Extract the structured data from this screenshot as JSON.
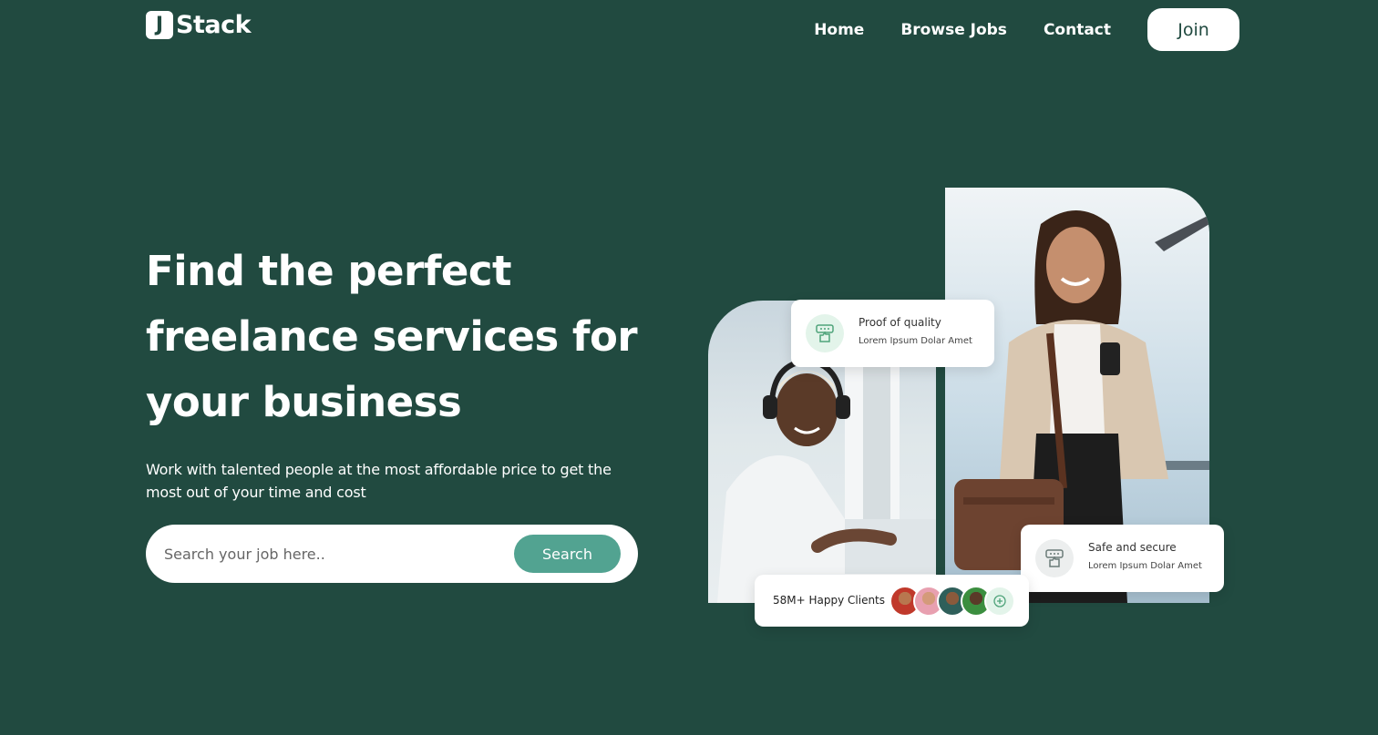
{
  "brand": {
    "mark": "J",
    "name": "Stack"
  },
  "nav": {
    "items": [
      "Home",
      "Browse Jobs",
      "Contact"
    ],
    "join_label": "Join"
  },
  "hero": {
    "title_lines": [
      "Find the perfect",
      "freelance services for",
      "your business"
    ],
    "subtitle": "Work with talented people at the most affordable price to get the most out of your time and cost",
    "search": {
      "placeholder": "Search your job here..",
      "button_label": "Search"
    }
  },
  "cards": {
    "quality": {
      "title": "Proof of quality",
      "text": "Lorem Ipsum Dolar Amet"
    },
    "safe": {
      "title": "Safe and secure",
      "text": "Lorem Ipsum Dolar Amet"
    },
    "clients": {
      "label": "58M+ Happy Clients"
    }
  },
  "colors": {
    "background": "#214a40",
    "accent": "#52a391",
    "card_icon_bg": "#e3f4ea"
  },
  "icons": [
    "thumbs-up-feedback-icon",
    "plus-circle-icon"
  ]
}
